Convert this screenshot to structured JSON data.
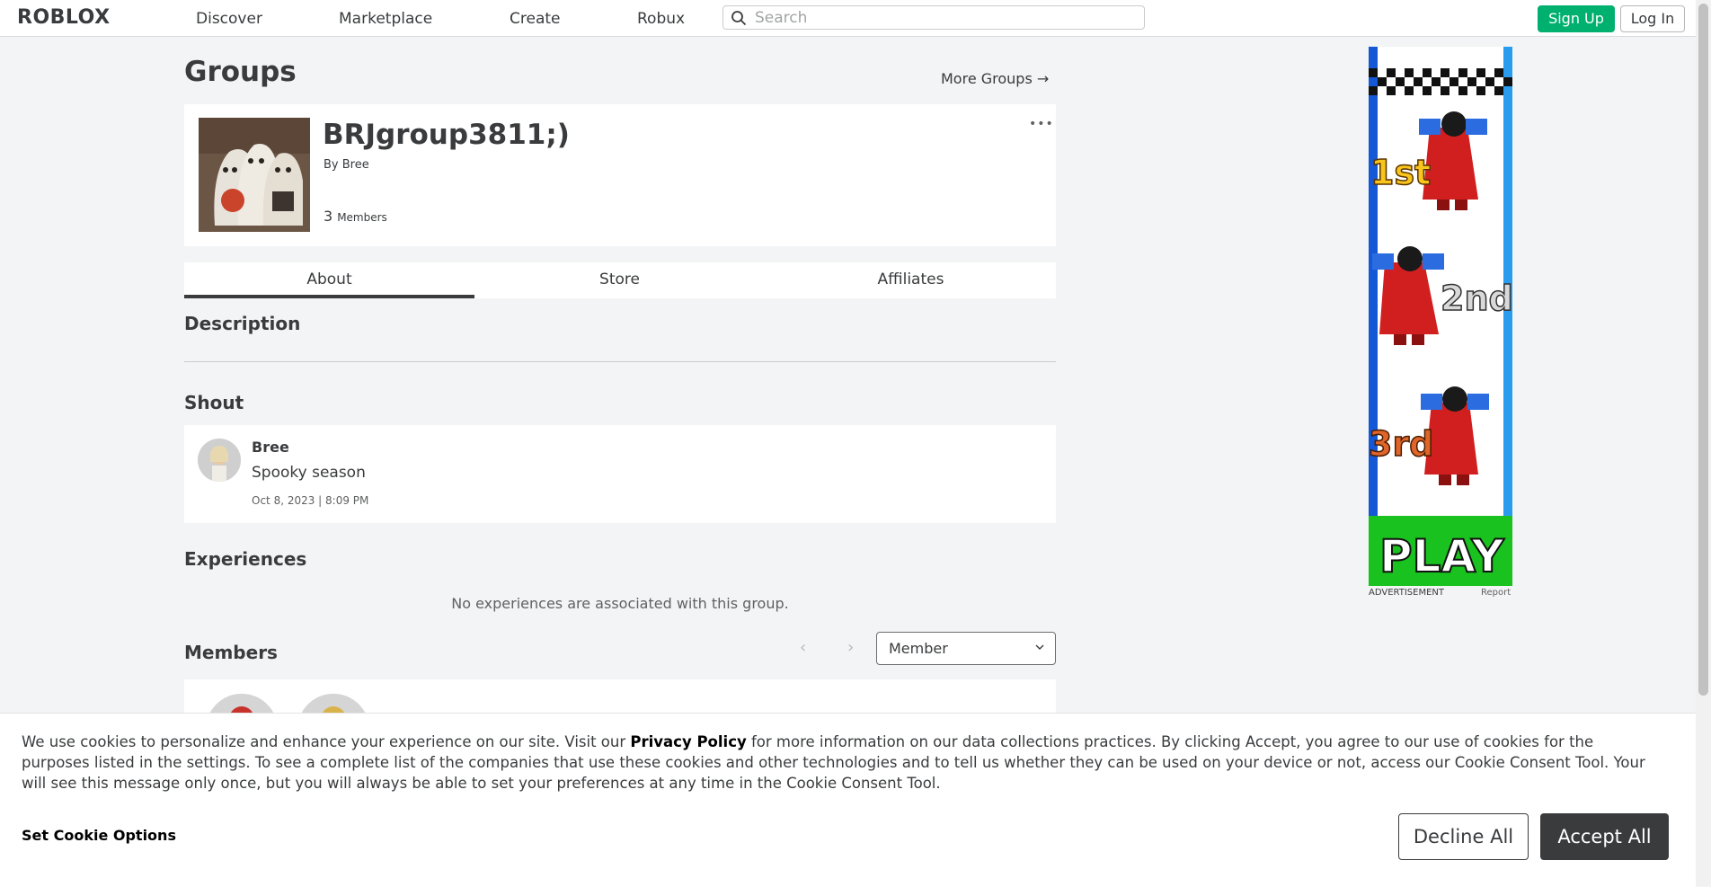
{
  "nav": {
    "logo": "ROBLOX",
    "links": [
      "Discover",
      "Marketplace",
      "Create",
      "Robux"
    ],
    "search_placeholder": "Search",
    "signup": "Sign Up",
    "login": "Log In"
  },
  "page": {
    "title": "Groups",
    "more_groups": "More Groups →"
  },
  "group": {
    "name": "BRJgroup3811;)",
    "by_prefix": "By",
    "owner": "Bree",
    "member_count": "3",
    "members_word": "Members",
    "menu": "•••"
  },
  "tabs": [
    "About",
    "Store",
    "Affiliates"
  ],
  "sections": {
    "description": "Description",
    "shout": "Shout",
    "experiences": "Experiences",
    "members": "Members"
  },
  "shout": {
    "author": "Bree",
    "text": "Spooky season",
    "date": "Oct 8, 2023 | 8:09 PM"
  },
  "experiences_empty": "No experiences are associated with this group.",
  "members_filter": {
    "selected": "Member",
    "prev": "‹",
    "next": "›"
  },
  "ad": {
    "label": "ADVERTISEMENT",
    "report": "Report",
    "texts": [
      "1st",
      "2nd",
      "3rd",
      "PLAY"
    ]
  },
  "cookie": {
    "text_before": "We use cookies to personalize and enhance your experience on our site. Visit our ",
    "privacy_link": "Privacy Policy",
    "text_after": " for more information on our data collections practices. By clicking Accept, you agree to our use of cookies for the purposes listed in the settings. To see a complete list of the companies that use these cookies and other technologies and to tell us whether they can be used on your device or not, access our Cookie Consent Tool. Your will see this message only once, but you will always be able to set your preferences at any time in the Cookie Consent Tool.",
    "set_options": "Set Cookie Options",
    "decline": "Decline All",
    "accept": "Accept All"
  },
  "colors": {
    "brand_green": "#00b06f",
    "text": "#393b3d",
    "page_bg": "#f2f4f5"
  }
}
